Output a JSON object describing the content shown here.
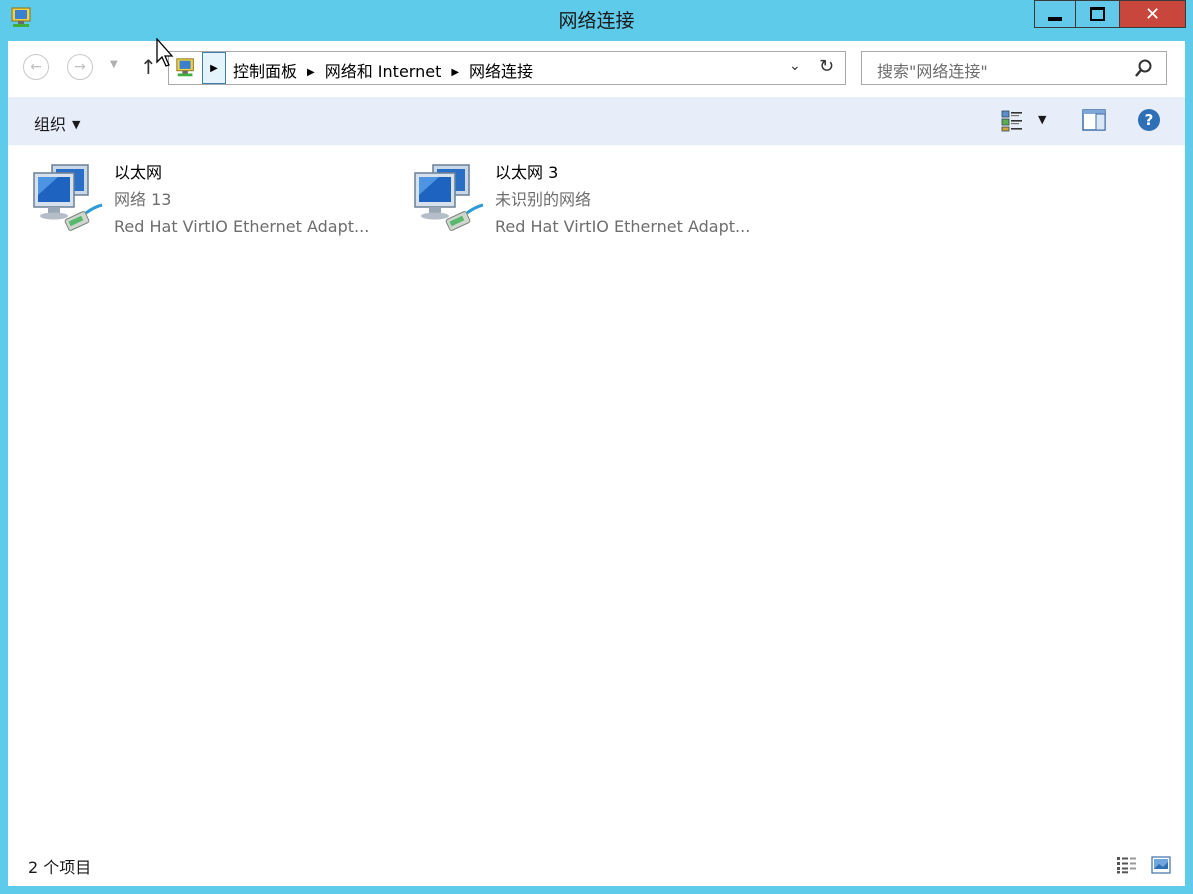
{
  "window": {
    "title": "网络连接"
  },
  "title_controls": {
    "close_glyph": "✕"
  },
  "nav": {
    "back_glyph": "←",
    "forward_glyph": "→",
    "recent_glyph": "▼",
    "up_glyph": "↑"
  },
  "address": {
    "breadcrumbs": [
      "控制面板",
      "网络和 Internet",
      "网络连接"
    ],
    "separator": "▶",
    "dropdown_glyph": "⌄",
    "refresh_glyph": "↻"
  },
  "search": {
    "placeholder": "搜索\"网络连接\""
  },
  "commandbar": {
    "organize_label": "组织",
    "caret": "▼",
    "help_glyph": "?"
  },
  "items": [
    {
      "name": "以太网",
      "network": "网络  13",
      "adapter": "Red Hat VirtIO Ethernet Adapt..."
    },
    {
      "name": "以太网 3",
      "network": "未识别的网络",
      "adapter": "Red Hat VirtIO Ethernet Adapt..."
    }
  ],
  "status": {
    "item_count": "2 个项目"
  },
  "icons": {
    "app": "network-connections-icon",
    "item": "ethernet-adapter-icon",
    "search": "search-icon",
    "help": "help-icon"
  },
  "colors": {
    "titlebar": "#5fcbea",
    "close_button": "#c8463c",
    "commandbar": "#e7eef9",
    "secondary_text": "#6d6d6d",
    "help_blue": "#2f6fb6"
  }
}
